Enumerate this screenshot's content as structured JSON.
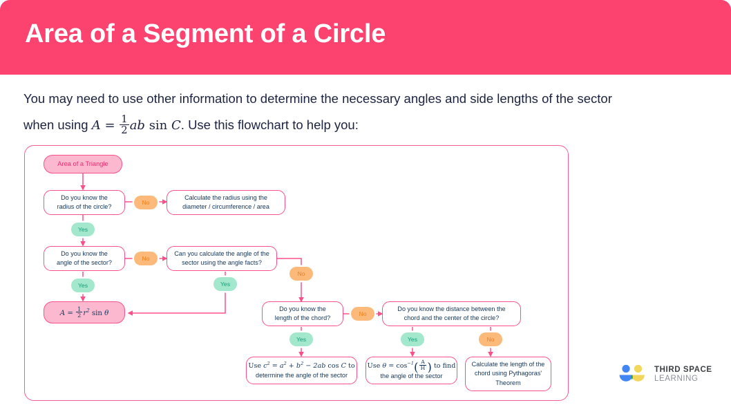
{
  "header": {
    "title": "Area of a Segment of a Circle",
    "band_color": "#fc4370",
    "title_color": "#ffffff"
  },
  "intro": {
    "part1": "You may need to use other information to determine the necessary angles and side lengths of the sector",
    "part2": "when using",
    "formula": "A = 1/2 ab sin C",
    "formula_parts": {
      "lhs": "A",
      "eq": "=",
      "num": "1",
      "den": "2",
      "rhs": "ab",
      "sin": "sin",
      "angle": "C"
    },
    "part3": ". Use this flowchart to help you:"
  },
  "flowchart": {
    "border_color": "#fa5d8d",
    "wire_color": "#f9508a",
    "node_text_color": "#12355b",
    "nodes": [
      {
        "id": "start",
        "kind": "start",
        "text": "Area of a Triangle"
      },
      {
        "id": "q-radius",
        "kind": "decision",
        "line1": "Do you know the",
        "line2": "radius of the circle?"
      },
      {
        "id": "calc-radius",
        "kind": "process",
        "line1": "Calculate the radius using the",
        "line2": "diameter / circumference / area"
      },
      {
        "id": "q-angle",
        "kind": "decision",
        "line1": "Do you know the",
        "line2": "angle of the sector?"
      },
      {
        "id": "q-anglefact",
        "kind": "decision",
        "line1": "Can you calculate the angle of the",
        "line2": "sector using the angle facts?"
      },
      {
        "id": "result-area",
        "kind": "result",
        "text": "A = 1/2 r^2 sin theta"
      },
      {
        "id": "q-chord",
        "kind": "decision",
        "line1": "Do you know the",
        "line2": "length of the chord?"
      },
      {
        "id": "q-distance",
        "kind": "decision",
        "line1": "Do you know the distance between the",
        "line2": "chord and the center of the circle?"
      },
      {
        "id": "use-cosine",
        "kind": "process",
        "line1": "Use c^2 = a^2 + b^2 - 2ab cos C to",
        "line2": "determine the angle of the sector"
      },
      {
        "id": "use-arccos",
        "kind": "process",
        "line1": "Use theta = cos^-1(A/H) to find",
        "line2": "the angle of the sector"
      },
      {
        "id": "use-pythag",
        "kind": "process",
        "line1": "Calculate the length of the",
        "line2": "chord using Pythagoras'",
        "line3": "Theorem"
      }
    ],
    "badges": {
      "yes": "Yes",
      "no": "No",
      "yes_bg": "#a3e8cd",
      "yes_fg": "#0f9e78",
      "no_bg": "#fbb97a",
      "no_fg": "#f08019"
    },
    "node_math": {
      "result_area": {
        "lhs": "A",
        "eq": "=",
        "num": "1",
        "den": "2",
        "r": "r",
        "rexp": "2",
        "sin": "sin",
        "theta": "θ"
      },
      "cosine_rule": {
        "c": "c",
        "cexp": "2",
        "eq": "=",
        "a": "a",
        "aexp": "2",
        "plus": "+",
        "b": "b",
        "bexp": "2",
        "minus": "−",
        "tail": "2ab",
        "cos": "cos",
        "angle": "C",
        "suffix": "to"
      },
      "arccos": {
        "prefix": "Use",
        "theta": "θ",
        "eq": "=",
        "cos": "cos",
        "inv": "−1",
        "num": "A",
        "den": "H",
        "suffix": "to find"
      }
    }
  },
  "logo": {
    "line1": "THIRD SPACE",
    "line2": "LEARNING",
    "blue": "#4285f4",
    "yellow": "#f2d75c",
    "green": "#2fa060"
  }
}
